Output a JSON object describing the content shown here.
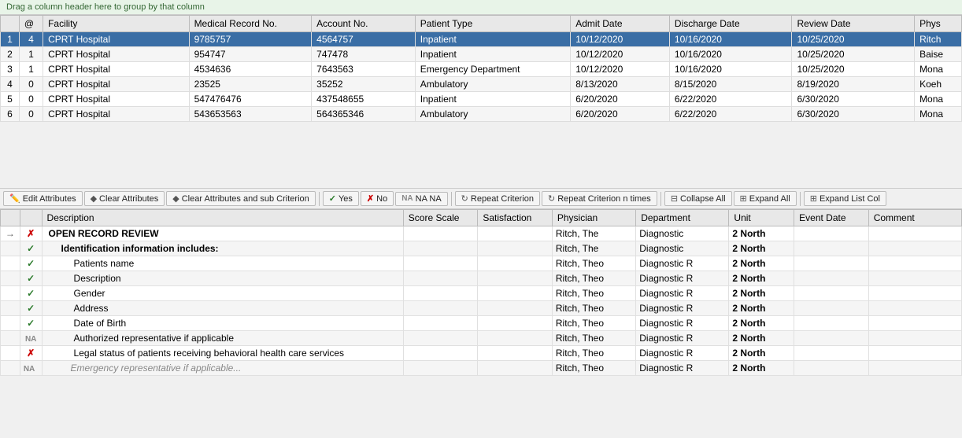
{
  "hint": "Drag a column header here to group by that column",
  "upper_grid": {
    "columns": [
      "",
      "@",
      "Facility",
      "Medical Record No.",
      "Account No.",
      "Patient Type",
      "Admit Date",
      "Discharge Date",
      "Review Date",
      "Phys"
    ],
    "rows": [
      {
        "num": 1,
        "at": 4,
        "facility": "CPRT Hospital",
        "mrn": "9785757",
        "acct": "4564757",
        "type": "Inpatient",
        "admit": "10/12/2020",
        "discharge": "10/16/2020",
        "review": "10/25/2020",
        "phys": "Ritch",
        "selected": true
      },
      {
        "num": 2,
        "at": 1,
        "facility": "CPRT Hospital",
        "mrn": "954747",
        "acct": "747478",
        "type": "Inpatient",
        "admit": "10/12/2020",
        "discharge": "10/16/2020",
        "review": "10/25/2020",
        "phys": "Baise",
        "selected": false
      },
      {
        "num": 3,
        "at": 1,
        "facility": "CPRT Hospital",
        "mrn": "4534636",
        "acct": "7643563",
        "type": "Emergency Department",
        "admit": "10/12/2020",
        "discharge": "10/16/2020",
        "review": "10/25/2020",
        "phys": "Mona",
        "selected": false
      },
      {
        "num": 4,
        "at": 0,
        "facility": "CPRT Hospital",
        "mrn": "23525",
        "acct": "35252",
        "type": "Ambulatory",
        "admit": "8/13/2020",
        "discharge": "8/15/2020",
        "review": "8/19/2020",
        "phys": "Koeh",
        "selected": false
      },
      {
        "num": 5,
        "at": 0,
        "facility": "CPRT Hospital",
        "mrn": "547476476",
        "acct": "437548655",
        "type": "Inpatient",
        "admit": "6/20/2020",
        "discharge": "6/22/2020",
        "review": "6/30/2020",
        "phys": "Mona",
        "selected": false
      },
      {
        "num": 6,
        "at": 0,
        "facility": "CPRT Hospital",
        "mrn": "543653563",
        "acct": "564365346",
        "type": "Ambulatory",
        "admit": "6/20/2020",
        "discharge": "6/22/2020",
        "review": "6/30/2020",
        "phys": "Mona",
        "selected": false
      }
    ]
  },
  "toolbar": {
    "edit_attr": "Edit Attributes",
    "clear_attr": "Clear Attributes",
    "clear_attr_sub": "Clear Attributes and sub Criterion",
    "yes": "Yes",
    "no": "No",
    "na": "NA NA",
    "repeat": "Repeat Criterion",
    "repeat_n": "Repeat Criterion n times",
    "collapse_all": "Collapse All",
    "expand_all": "Expand All",
    "expand_list": "Expand List Col"
  },
  "lower_grid": {
    "columns": [
      "",
      "",
      "Description",
      "Score Scale",
      "Satisfaction",
      "Physician",
      "Department",
      "Unit",
      "Event Date",
      "Comment"
    ],
    "rows": [
      {
        "arrow": "→",
        "indent": 0,
        "icon": "cross",
        "label": "OPEN RECORD REVIEW",
        "bold": true,
        "score": "",
        "satisfaction": "",
        "physician": "Ritch, The",
        "department": "Diagnostic",
        "unit": "2 North",
        "event_date": "",
        "comment": ""
      },
      {
        "arrow": "",
        "indent": 1,
        "icon": "check",
        "label": "Identification information includes:",
        "bold": true,
        "score": "",
        "satisfaction": "",
        "physician": "Ritch, The",
        "department": "Diagnostic",
        "unit": "2 North",
        "event_date": "",
        "comment": ""
      },
      {
        "arrow": "",
        "indent": 2,
        "icon": "check",
        "label": "Patients name",
        "bold": false,
        "score": "",
        "satisfaction": "",
        "physician": "Ritch, Theo",
        "department": "Diagnostic R",
        "unit": "2 North",
        "event_date": "",
        "comment": ""
      },
      {
        "arrow": "",
        "indent": 2,
        "icon": "check",
        "label": "Description",
        "bold": false,
        "score": "",
        "satisfaction": "",
        "physician": "Ritch, Theo",
        "department": "Diagnostic R",
        "unit": "2 North",
        "event_date": "",
        "comment": ""
      },
      {
        "arrow": "",
        "indent": 2,
        "icon": "check",
        "label": "Gender",
        "bold": false,
        "score": "",
        "satisfaction": "",
        "physician": "Ritch, Theo",
        "department": "Diagnostic R",
        "unit": "2 North",
        "event_date": "",
        "comment": ""
      },
      {
        "arrow": "",
        "indent": 2,
        "icon": "check",
        "label": "Address",
        "bold": false,
        "score": "",
        "satisfaction": "",
        "physician": "Ritch, Theo",
        "department": "Diagnostic R",
        "unit": "2 North",
        "event_date": "",
        "comment": ""
      },
      {
        "arrow": "",
        "indent": 2,
        "icon": "check",
        "label": "Date of Birth",
        "bold": false,
        "score": "",
        "satisfaction": "",
        "physician": "Ritch, Theo",
        "department": "Diagnostic R",
        "unit": "2 North",
        "event_date": "",
        "comment": ""
      },
      {
        "arrow": "",
        "indent": 2,
        "icon": "na",
        "label": "Authorized representative if applicable",
        "bold": false,
        "score": "",
        "satisfaction": "",
        "physician": "Ritch, Theo",
        "department": "Diagnostic R",
        "unit": "2 North",
        "event_date": "",
        "comment": ""
      },
      {
        "arrow": "",
        "indent": 2,
        "icon": "cross",
        "label": "Legal status of patients receiving behavioral health care services",
        "bold": false,
        "score": "",
        "satisfaction": "",
        "physician": "Ritch, Theo",
        "department": "Diagnostic R",
        "unit": "2 North",
        "event_date": "",
        "comment": ""
      },
      {
        "arrow": "",
        "indent": 2,
        "icon": "na",
        "label": "...",
        "bold": false,
        "score": "",
        "satisfaction": "",
        "physician": "Ritch, Theo",
        "department": "Diagnostic R",
        "unit": "2 North",
        "event_date": "",
        "comment": ""
      }
    ]
  }
}
